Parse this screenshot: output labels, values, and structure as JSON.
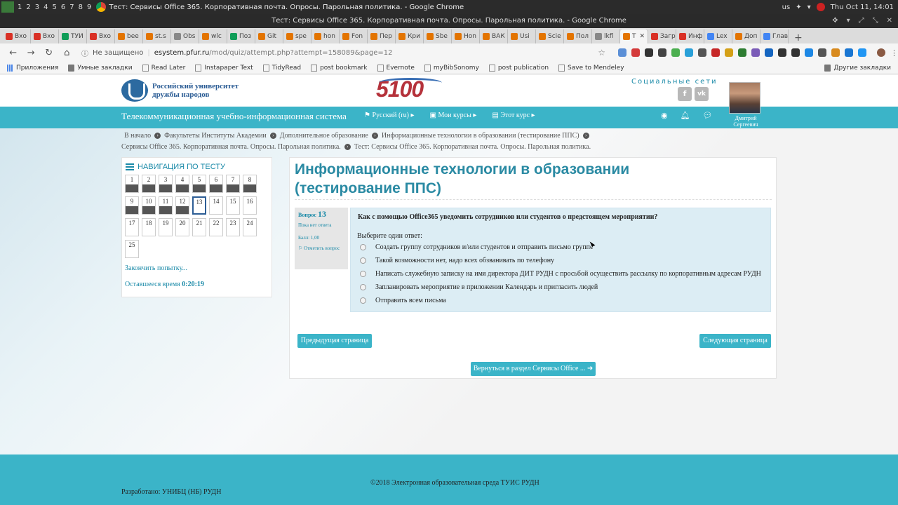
{
  "system": {
    "workspaces": [
      "1",
      "2",
      "3",
      "4",
      "5",
      "6",
      "7",
      "8",
      "9"
    ],
    "window_title": "Тест: Сервисы Office 365. Корпоративная почта. Опросы. Парольная политика. - Google Chrome",
    "keyboard_layout": "us",
    "clock": "Thu Oct 11, 14:01"
  },
  "browser": {
    "title": "Тест: Сервисы Office 365. Корпоративная почта. Опросы. Парольная политика. - Google Chrome",
    "tabs": [
      {
        "label": "Вхо",
        "color": "#d93025"
      },
      {
        "label": "Вхо",
        "color": "#d93025"
      },
      {
        "label": "ТУИ",
        "color": "#0f9d58"
      },
      {
        "label": "Вхо",
        "color": "#d93025"
      },
      {
        "label": "bee",
        "color": "#e37400"
      },
      {
        "label": "st.s",
        "color": "#e37400"
      },
      {
        "label": "Obs",
        "color": "#888888"
      },
      {
        "label": "wlc",
        "color": "#e37400"
      },
      {
        "label": "Поз",
        "color": "#0f9d58"
      },
      {
        "label": "Git",
        "color": "#e37400"
      },
      {
        "label": "spe",
        "color": "#e37400"
      },
      {
        "label": "hon",
        "color": "#e37400"
      },
      {
        "label": "Fon",
        "color": "#e37400"
      },
      {
        "label": "Пер",
        "color": "#e37400"
      },
      {
        "label": "Кри",
        "color": "#e37400"
      },
      {
        "label": "Sbe",
        "color": "#e37400"
      },
      {
        "label": "Hon",
        "color": "#e37400"
      },
      {
        "label": "ВАК",
        "color": "#e37400"
      },
      {
        "label": "Usi",
        "color": "#e37400"
      },
      {
        "label": "Scie",
        "color": "#e37400"
      },
      {
        "label": "Пол",
        "color": "#e37400"
      },
      {
        "label": "lkfl",
        "color": "#888888"
      },
      {
        "label": "Т",
        "color": "#e37400",
        "active": true
      },
      {
        "label": "Загр",
        "color": "#d93025"
      },
      {
        "label": "Инф",
        "color": "#d93025"
      },
      {
        "label": "Lex",
        "color": "#4285f4"
      },
      {
        "label": "Доп",
        "color": "#e37400"
      },
      {
        "label": "Глав",
        "color": "#4285f4"
      }
    ],
    "security_label": "Не защищено",
    "url_host": "esystem.pfur.ru",
    "url_path": "/mod/quiz/attempt.php?attempt=158089&page=12",
    "bookmarks": [
      "Приложения",
      "Умные закладки",
      "Read Later",
      "Instapaper Text",
      "TidyRead",
      "post bookmark",
      "Evernote",
      "myBibSonomy",
      "post publication",
      "Save to Mendeley"
    ],
    "other_bookmarks": "Другие закладки"
  },
  "site": {
    "university_name_line1": "Российский университет",
    "university_name_line2": "дружбы народов",
    "logo_5100": "5100",
    "social_label": "Социальные сети",
    "social": [
      "f",
      "vk"
    ],
    "system_name": "Телекоммуникационная учебно-информационная система",
    "menu": [
      "Русский (ru)",
      "Мои курсы",
      "Этот курс"
    ],
    "user_name": "Дмитрий Сергеевич"
  },
  "breadcrumb": [
    "В начало",
    "Факультеты Институты Академии",
    "Дополнительное образование",
    "Информационные технологии в образовании (тестирование ППС)",
    "Сервисы Office 365. Корпоративная почта. Опросы. Парольная политика.",
    "Тест: Сервисы Office 365. Корпоративная почта. Опросы. Парольная политика."
  ],
  "quiz_nav": {
    "heading": "НАВИГАЦИЯ ПО ТЕСТУ",
    "questions": [
      {
        "n": "1",
        "state": "done"
      },
      {
        "n": "2",
        "state": "done"
      },
      {
        "n": "3",
        "state": "done"
      },
      {
        "n": "4",
        "state": "done"
      },
      {
        "n": "5",
        "state": "done"
      },
      {
        "n": "6",
        "state": "done"
      },
      {
        "n": "7",
        "state": "done"
      },
      {
        "n": "8",
        "state": "done"
      },
      {
        "n": "9",
        "state": "done"
      },
      {
        "n": "10",
        "state": "done"
      },
      {
        "n": "11",
        "state": "done"
      },
      {
        "n": "12",
        "state": "done"
      },
      {
        "n": "13",
        "state": "current"
      },
      {
        "n": "14",
        "state": "empty"
      },
      {
        "n": "15",
        "state": "empty"
      },
      {
        "n": "16",
        "state": "empty"
      },
      {
        "n": "17",
        "state": "empty"
      },
      {
        "n": "18",
        "state": "empty"
      },
      {
        "n": "19",
        "state": "empty"
      },
      {
        "n": "20",
        "state": "empty"
      },
      {
        "n": "21",
        "state": "empty"
      },
      {
        "n": "22",
        "state": "empty"
      },
      {
        "n": "23",
        "state": "empty"
      },
      {
        "n": "24",
        "state": "empty"
      },
      {
        "n": "25",
        "state": "empty"
      }
    ],
    "finish_label": "Закончить попытку...",
    "time_left_label": "Оставшееся время",
    "time_left": "0:20:19"
  },
  "main": {
    "title": "Информационные технологии в образовании (тестирование ППС)",
    "question_label": "Вопрос",
    "question_number": "13",
    "status": "Пока нет ответа",
    "score": "Балл: 1,00",
    "flag_label": "Отметить вопрос",
    "question_text": "Как с помощью Office365 уведомить сотрудников или студентов о предстоящем мероприятии?",
    "prompt": "Выберите один ответ:",
    "options": [
      "Создать группу сотрудников и/или студентов и отправить письмо группе",
      "Такой возможности нет, надо всех обзванивать по телефону",
      "Написать служебную записку на имя директора ДИТ РУДН с просьбой осуществить рассылку по корпоративным адресам РУДН",
      "Запланировать мероприятие в приложении Календарь и пригласить людей",
      "Отправить всем письма"
    ],
    "prev_button": "Предыдущая страница",
    "next_button": "Следующая страница",
    "return_button": "Вернуться в раздел Сервисы Office ..."
  },
  "footer": {
    "copyright": "©2018 Электронная образовательная среда ТУИС РУДН",
    "developer": "Разработано: УНИБЦ (НБ) РУДН"
  },
  "colors": {
    "accent": "#3bb4c8",
    "title": "#2a8aa3",
    "question_bg": "#dcedf4",
    "link": "#1a8aa8"
  }
}
